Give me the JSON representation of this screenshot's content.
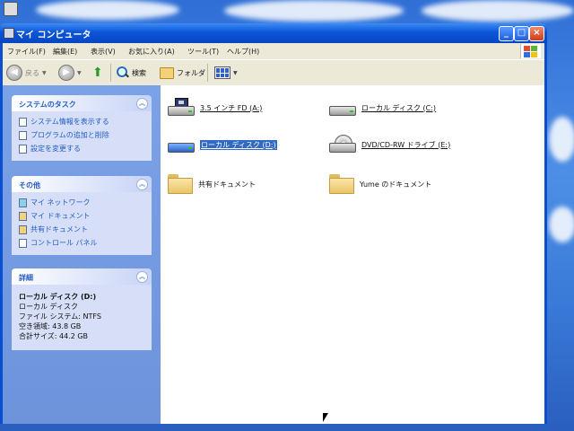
{
  "window": {
    "title": "マイ コンピュータ"
  },
  "menubar": [
    "ファイル(F)",
    "編集(E)",
    "表示(V)",
    "お気に入り(A)",
    "ツール(T)",
    "ヘルプ(H)"
  ],
  "toolbar": {
    "back_label": "戻る",
    "search_label": "検索",
    "folders_label": "フォルダ"
  },
  "taskpane": {
    "system_tasks": {
      "title": "システムのタスク",
      "items": [
        "システム情報を表示する",
        "プログラムの追加と削除",
        "設定を変更する"
      ]
    },
    "other_places": {
      "title": "その他",
      "items": [
        "マイ ネットワーク",
        "マイ ドキュメント",
        "共有ドキュメント",
        "コントロール パネル"
      ]
    },
    "details": {
      "title": "詳細",
      "name": "ローカル ディスク (D:)",
      "type": "ローカル ディスク",
      "filesystem": "ファイル システム: NTFS",
      "free": "空き領域: 43.8 GB",
      "total": "合計サイズ: 44.2 GB"
    }
  },
  "files": [
    {
      "label": "3.5 インチ FD (A:)",
      "icon": "floppy-drive-icon",
      "selected": false
    },
    {
      "label": "ローカル ディスク (C:)",
      "icon": "hard-disk-icon",
      "selected": false
    },
    {
      "label": "ローカル ディスク (D:)",
      "icon": "hard-disk-icon",
      "selected": true
    },
    {
      "label": "DVD/CD-RW ドライブ (E:)",
      "icon": "cd-drive-icon",
      "selected": false
    },
    {
      "label": "共有ドキュメント",
      "icon": "folder-icon",
      "selected": false
    },
    {
      "label": "Yume のドキュメント",
      "icon": "folder-icon",
      "selected": false
    }
  ],
  "colors": {
    "titlebar": "#0b55d8",
    "taskpane": "#6d93dc",
    "selection": "#316ac5",
    "link": "#215dc6"
  }
}
